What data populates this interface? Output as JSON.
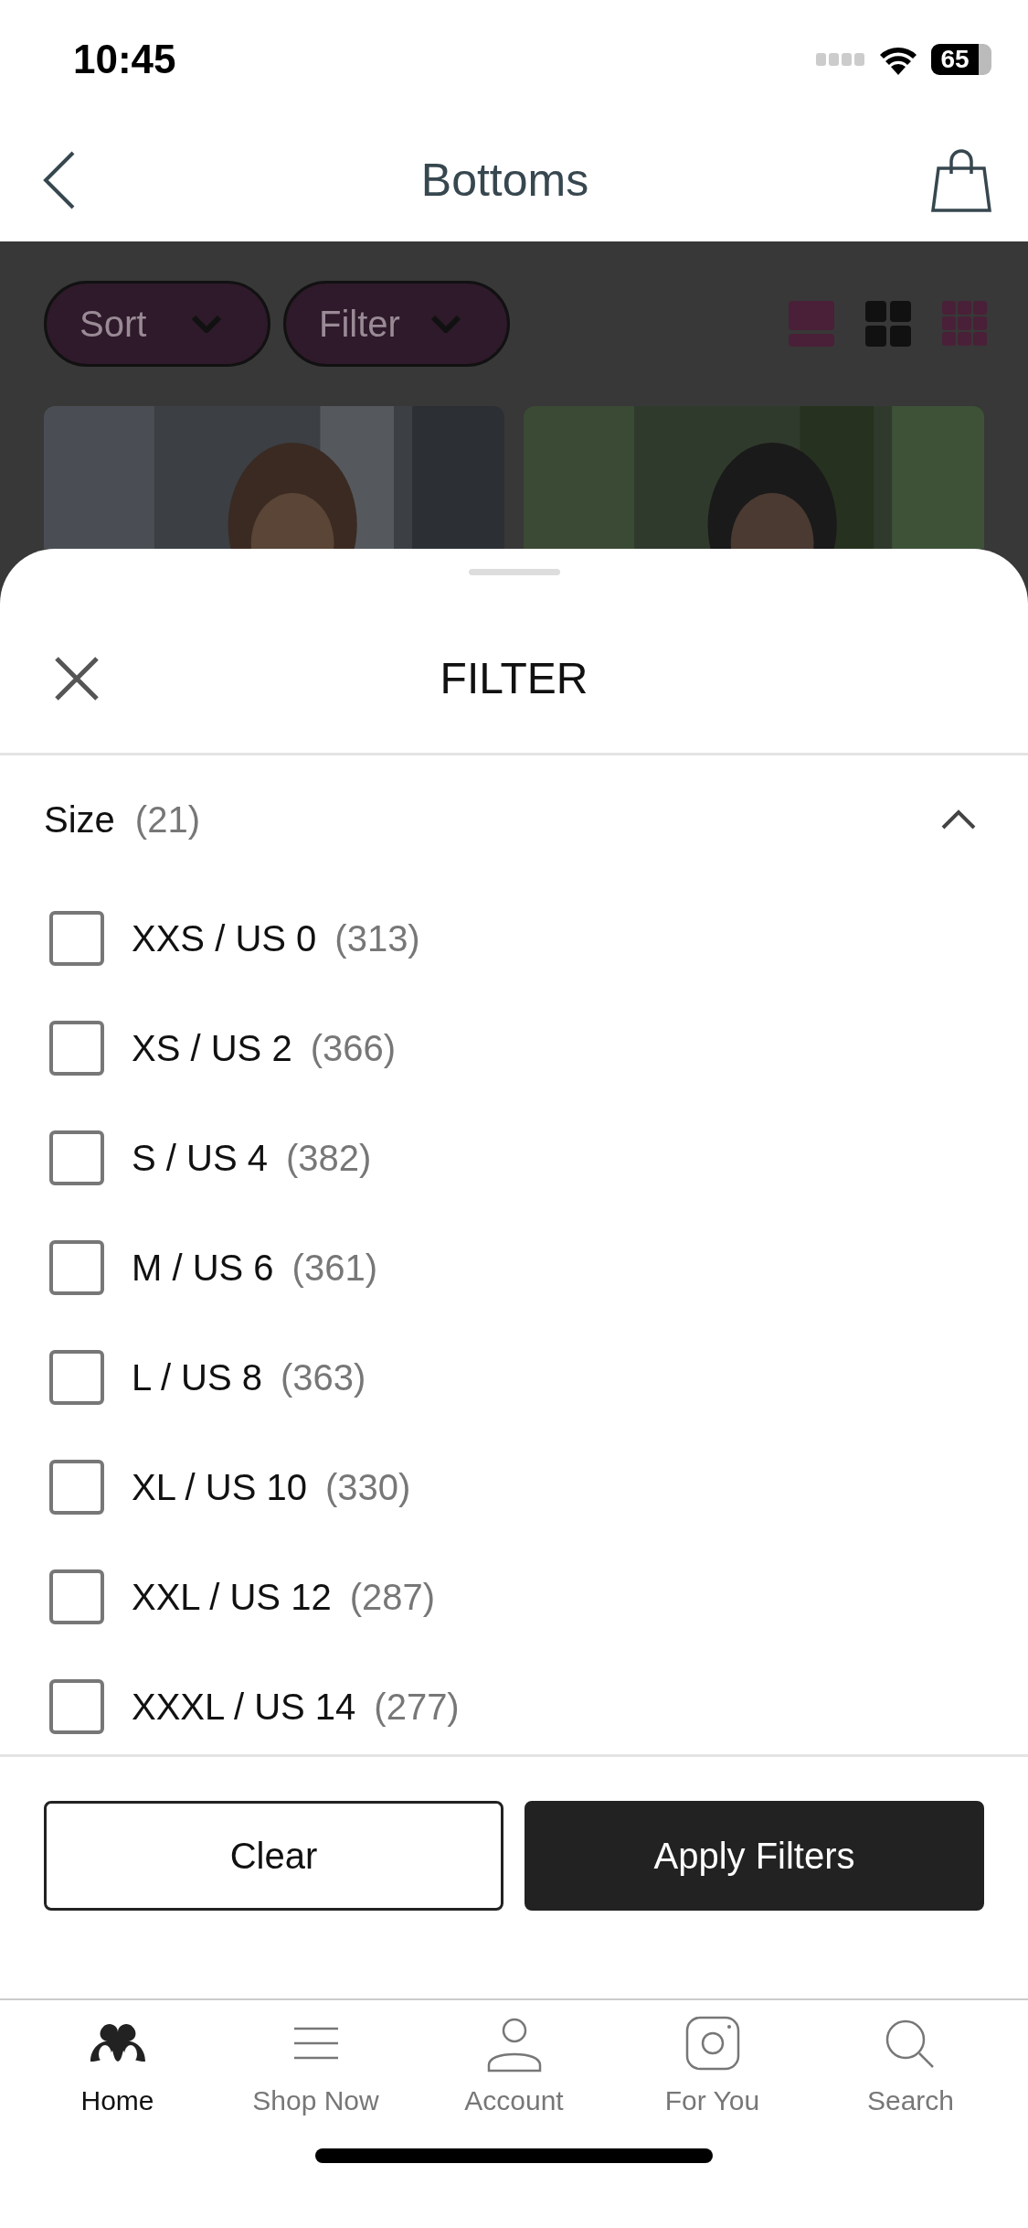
{
  "status_bar": {
    "time": "10:45",
    "battery": "65"
  },
  "nav": {
    "title": "Bottoms"
  },
  "toolbar": {
    "pills": [
      {
        "label": "Sort"
      },
      {
        "label": "Filter"
      }
    ],
    "views": [
      {
        "kind": "single",
        "selected": false
      },
      {
        "kind": "grid2",
        "selected": true
      },
      {
        "kind": "grid3",
        "selected": false
      }
    ]
  },
  "sheet": {
    "title": "FILTER",
    "section": {
      "label": "Size",
      "count": "(21)",
      "expanded": true,
      "options": [
        {
          "label": "XXS / US 0",
          "count": "(313)",
          "checked": false
        },
        {
          "label": "XS / US 2",
          "count": "(366)",
          "checked": false
        },
        {
          "label": "S / US 4",
          "count": "(382)",
          "checked": false
        },
        {
          "label": "M / US 6",
          "count": "(361)",
          "checked": false
        },
        {
          "label": "L / US 8",
          "count": "(363)",
          "checked": false
        },
        {
          "label": "XL / US 10",
          "count": "(330)",
          "checked": false
        },
        {
          "label": "XXL / US 12",
          "count": "(287)",
          "checked": false
        },
        {
          "label": "XXXL / US 14",
          "count": "(277)",
          "checked": false
        }
      ]
    },
    "buttons": [
      {
        "label": "Clear",
        "kind": "secondary"
      },
      {
        "label": "Apply Filters",
        "kind": "primary"
      }
    ]
  },
  "tab_bar": [
    {
      "label": "Home",
      "kind": "logo",
      "selected": true
    },
    {
      "label": "Shop Now",
      "kind": "menu",
      "selected": false
    },
    {
      "label": "Account",
      "kind": "person",
      "selected": false
    },
    {
      "label": "For You",
      "kind": "camera",
      "selected": false
    },
    {
      "label": "Search",
      "kind": "search",
      "selected": false
    }
  ]
}
